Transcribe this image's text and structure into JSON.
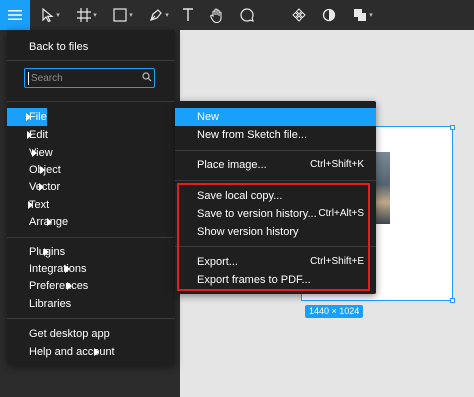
{
  "toolbar": {
    "items": [
      "menu-icon",
      "move-tool-icon",
      "frame-tool-icon",
      "shape-tool-icon",
      "pen-tool-icon",
      "text-tool-icon",
      "hand-tool-icon",
      "comment-tool-icon",
      "component-icon",
      "mask-icon",
      "boolean-icon"
    ],
    "accent": "#18a0fb"
  },
  "main_menu": {
    "back": "Back to files",
    "search_placeholder": "Search",
    "items": [
      {
        "label": "File",
        "submenu": true,
        "active": true
      },
      {
        "label": "Edit",
        "submenu": true
      },
      {
        "label": "View",
        "submenu": true
      },
      {
        "label": "Object",
        "submenu": true
      },
      {
        "label": "Vector",
        "submenu": true
      },
      {
        "label": "Text",
        "submenu": true
      },
      {
        "label": "Arrange",
        "submenu": true
      },
      {
        "label": "Plugins",
        "submenu": true
      },
      {
        "label": "Integrations",
        "submenu": true
      },
      {
        "label": "Preferences",
        "submenu": true
      },
      {
        "label": "Libraries",
        "submenu": false
      },
      {
        "label": "Get desktop app",
        "submenu": false
      },
      {
        "label": "Help and account",
        "submenu": true
      }
    ]
  },
  "file_menu": {
    "items": [
      {
        "label": "New",
        "shortcut": "",
        "active": true
      },
      {
        "label": "New from Sketch file...",
        "shortcut": ""
      },
      {
        "label": "Place image...",
        "shortcut": "Ctrl+Shift+K"
      },
      {
        "label": "Save local copy...",
        "shortcut": ""
      },
      {
        "label": "Save to version history...",
        "shortcut": "Ctrl+Alt+S"
      },
      {
        "label": "Show version history",
        "shortcut": ""
      },
      {
        "label": "Export...",
        "shortcut": "Ctrl+Shift+E"
      },
      {
        "label": "Export frames to PDF...",
        "shortcut": ""
      }
    ]
  },
  "canvas": {
    "frame_size": "1440 × 1024"
  }
}
